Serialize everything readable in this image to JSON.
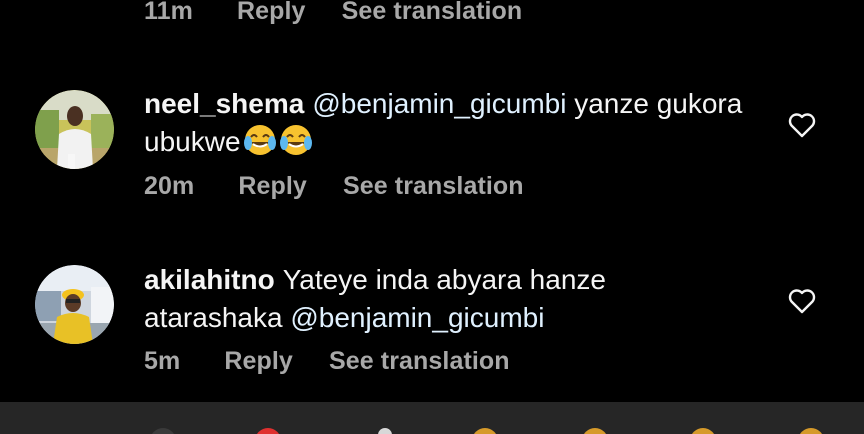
{
  "previous_comment": {
    "time": "11m",
    "reply_label": "Reply",
    "translate_label": "See translation"
  },
  "comments": [
    {
      "username": "neel_shema",
      "mention": "@benjamin_gicumbi",
      "text_after_mention": "yanze gukora ubukwe",
      "emojis": [
        "face-with-tears-of-joy",
        "face-with-tears-of-joy"
      ],
      "time": "20m",
      "reply_label": "Reply",
      "translate_label": "See translation"
    },
    {
      "username": "akilahitno",
      "text_before_mention": "Yateye inda abyara hanze atarashaka",
      "mention": "@benjamin_gicumbi",
      "time": "5m",
      "reply_label": "Reply",
      "translate_label": "See translation"
    }
  ],
  "colors": {
    "background": "#000000",
    "secondary_text": "#a8a8a8",
    "primary_text": "#f5f5f5",
    "mention": "#e0f1ff",
    "bottom_bar": "#262626"
  },
  "icons": {
    "like": "heart-outline-icon",
    "emoji": "face-with-tears-of-joy"
  }
}
